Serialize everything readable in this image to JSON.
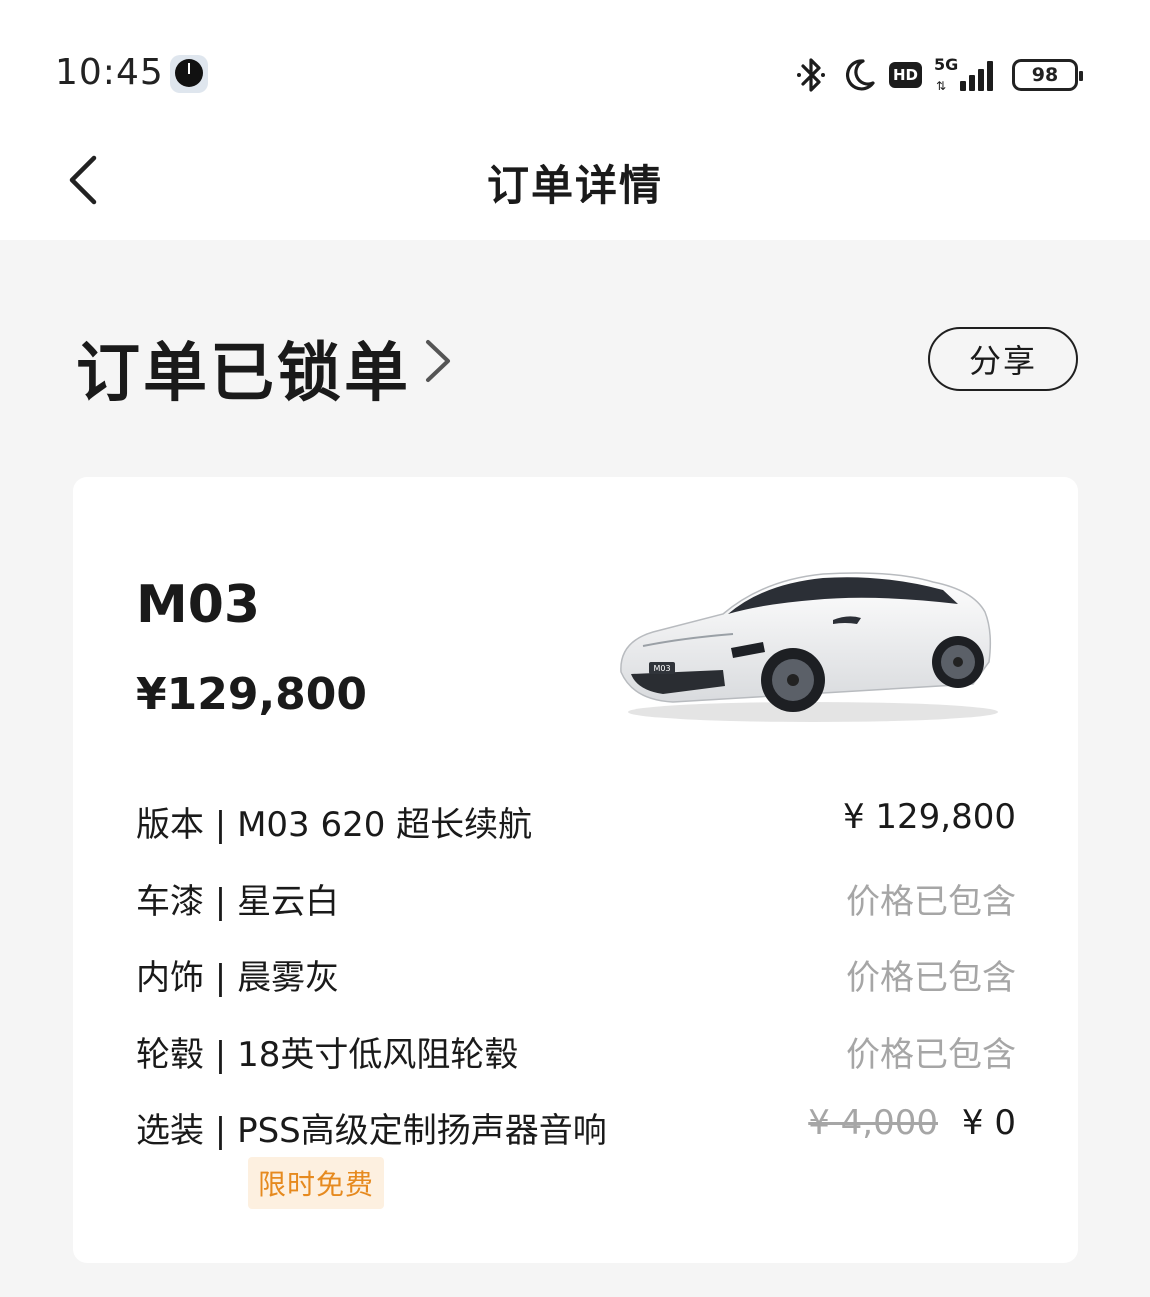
{
  "status_bar": {
    "time": "10:45",
    "icons": [
      "clock-app-icon",
      "bluetooth-icon",
      "moon-icon",
      "hd-icon",
      "signal-5g-icon",
      "battery-icon"
    ],
    "hd": "HD",
    "network": "5G",
    "battery": "98"
  },
  "nav": {
    "title": "订单详情"
  },
  "order": {
    "status": "订单已锁单",
    "share_label": "分享"
  },
  "car": {
    "model": "M03",
    "price": "¥129,800",
    "badge_text": "M03",
    "body_color": "#f1f2f3"
  },
  "rows": [
    {
      "label": "版本 | M03 620 超长续航",
      "value": "¥ 129,800"
    },
    {
      "label": "车漆 | 星云白",
      "value": "价格已包含"
    },
    {
      "label": "内饰 | 晨雾灰",
      "value": "价格已包含"
    },
    {
      "label": "轮毂 | 18英寸低风阻轮毂",
      "value": "价格已包含"
    },
    {
      "label": "选装 | PSS高级定制扬声器音响",
      "original_price": "¥ 4,000",
      "value": "¥ 0"
    }
  ],
  "promo": {
    "tag": "限时免费"
  },
  "colors": {
    "muted": "#a6a6a6",
    "tag_bg": "#fdf0e0",
    "tag_text": "#e68a1f",
    "page_bg": "#f5f5f5"
  }
}
